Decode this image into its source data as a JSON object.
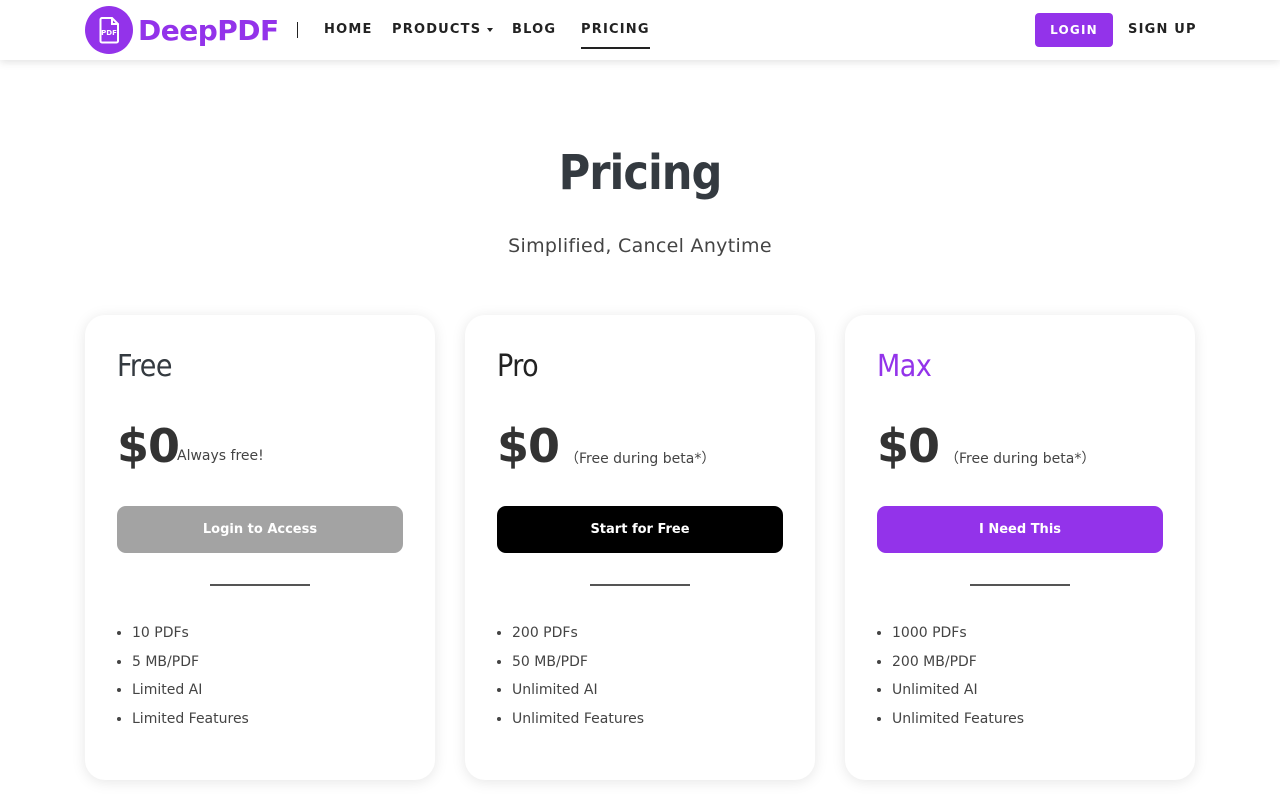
{
  "brand": {
    "name": "DeepPDF",
    "accent": "#9333ea",
    "mark_text": "PDF"
  },
  "nav": {
    "home": "HOME",
    "products": "PRODUCTS",
    "blog": "BLOG",
    "pricing": "PRICING",
    "login": "LOGIN",
    "signup": "SIGN UP",
    "active": "PRICING"
  },
  "hero": {
    "title": "Pricing",
    "subtitle": "Simplified, Cancel Anytime"
  },
  "plans": [
    {
      "name": "Free",
      "price": "$0",
      "note": "Always free!",
      "cta": "Login to Access",
      "features": [
        "10 PDFs",
        "5 MB/PDF",
        "Limited AI",
        "Limited Features"
      ]
    },
    {
      "name": "Pro",
      "price": "$0",
      "note": "（Free during beta*）",
      "cta": "Start for Free",
      "features": [
        "200 PDFs",
        "50 MB/PDF",
        "Unlimited AI",
        "Unlimited Features"
      ]
    },
    {
      "name": "Max",
      "price": "$0",
      "note": "（Free during beta*）",
      "cta": "I Need This",
      "features": [
        "1000 PDFs",
        "200 MB/PDF",
        "Unlimited AI",
        "Unlimited Features"
      ]
    }
  ]
}
